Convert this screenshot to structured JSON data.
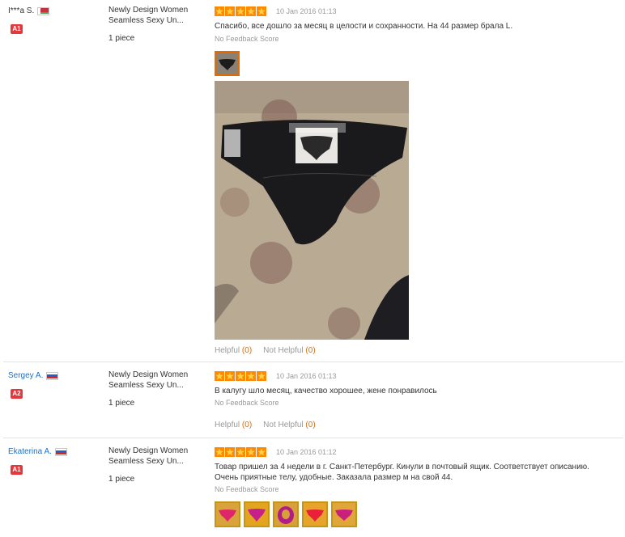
{
  "reviews": [
    {
      "buyer": "I***a S.",
      "country": "by",
      "level": "A1",
      "product_line1": "Newly Design Women",
      "product_line2": "Seamless Sexy Un...",
      "quantity": "1 piece",
      "rating": 5,
      "date": "10 Jan 2016 01:13",
      "text": "Спасибо, все дошло за месяц в целости и сохранности. На 44 размер брала L.",
      "feedback_score": "No Feedback Score",
      "helpful_label": "Helpful",
      "helpful_open": "(",
      "helpful_count": "0",
      "helpful_close": ")",
      "not_helpful_label": "Not Helpful",
      "not_helpful_count": "0"
    },
    {
      "buyer": "Sergey A.",
      "country": "ru",
      "level": "A2",
      "product_line1": "Newly Design Women",
      "product_line2": "Seamless Sexy Un...",
      "quantity": "1 piece",
      "rating": 5,
      "date": "10 Jan 2016 01:13",
      "text": "В калугу шло месяц, качество хорошее, жене понравилось",
      "feedback_score": "No Feedback Score",
      "helpful_label": "Helpful",
      "helpful_count": "0",
      "not_helpful_label": "Not Helpful",
      "not_helpful_count": "0"
    },
    {
      "buyer": "Ekaterina A.",
      "country": "ru",
      "level": "A1",
      "product_line1": "Newly Design Women",
      "product_line2": "Seamless Sexy Un...",
      "quantity": "1 piece",
      "rating": 5,
      "date": "10 Jan 2016 01:12",
      "text_line1": "Товар пришел за 4 недели в г. Санкт-Петербург. Кинули в почтовый ящик. Соответствует описанию.",
      "text_line2": "Очень приятные телу, удобные. Заказала размер м на свой 44.",
      "feedback_score": "No Feedback Score",
      "photo_count": 5
    }
  ],
  "colors": {
    "star": "#ff8a00",
    "accent": "#e46b00",
    "level_badge": "#e4393c",
    "link": "#1f6fc5"
  }
}
